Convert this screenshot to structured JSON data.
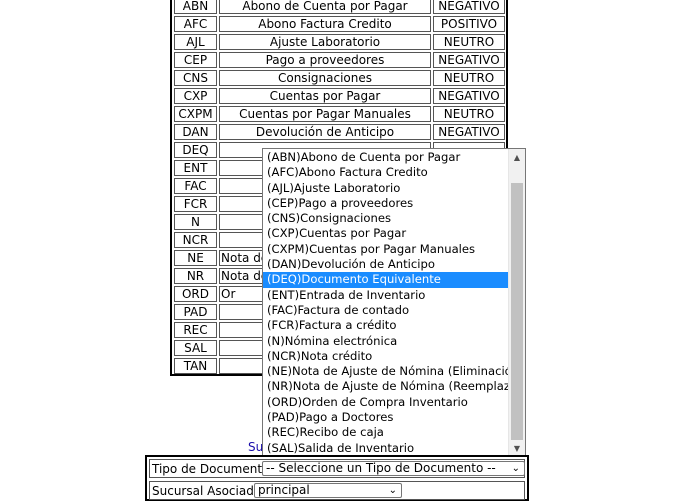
{
  "table": {
    "rows": [
      {
        "code": "ABN",
        "desc": "Abono de Cuenta por Pagar",
        "tipo": "NEGATIVO"
      },
      {
        "code": "AFC",
        "desc": "Abono Factura Credito",
        "tipo": "POSITIVO"
      },
      {
        "code": "AJL",
        "desc": "Ajuste Laboratorio",
        "tipo": "NEUTRO"
      },
      {
        "code": "CEP",
        "desc": "Pago a proveedores",
        "tipo": "NEGATIVO"
      },
      {
        "code": "CNS",
        "desc": "Consignaciones",
        "tipo": "NEUTRO"
      },
      {
        "code": "CXP",
        "desc": "Cuentas por Pagar",
        "tipo": "NEGATIVO"
      },
      {
        "code": "CXPM",
        "desc": "Cuentas por Pagar Manuales",
        "tipo": "NEUTRO"
      },
      {
        "code": "DAN",
        "desc": "Devolución de Anticipo",
        "tipo": "NEGATIVO"
      },
      {
        "code": "DEQ",
        "desc": "",
        "tipo": ""
      },
      {
        "code": "ENT",
        "desc": "",
        "tipo": ""
      },
      {
        "code": "FAC",
        "desc": "",
        "tipo": ""
      },
      {
        "code": "FCR",
        "desc": "",
        "tipo": ""
      },
      {
        "code": "N",
        "desc": "",
        "tipo": ""
      },
      {
        "code": "NCR",
        "desc": "",
        "tipo": ""
      },
      {
        "code": "NE",
        "desc": "Nota de",
        "tipo": ""
      },
      {
        "code": "NR",
        "desc": "Nota de",
        "tipo": ""
      },
      {
        "code": "ORD",
        "desc": "Or",
        "tipo": ""
      },
      {
        "code": "PAD",
        "desc": "",
        "tipo": ""
      },
      {
        "code": "REC",
        "desc": "",
        "tipo": ""
      },
      {
        "code": "SAL",
        "desc": "",
        "tipo": ""
      },
      {
        "code": "TAN",
        "desc": "",
        "tipo": ""
      }
    ]
  },
  "dropdown": {
    "selected_index": 8,
    "options": [
      "(ABN)Abono de Cuenta por Pagar",
      "(AFC)Abono Factura Credito",
      "(AJL)Ajuste Laboratorio",
      "(CEP)Pago a proveedores",
      "(CNS)Consignaciones",
      "(CXP)Cuentas por Pagar",
      "(CXPM)Cuentas por Pagar Manuales",
      "(DAN)Devolución de Anticipo",
      "(DEQ)Documento Equivalente",
      "(ENT)Entrada de Inventario",
      "(FAC)Factura de contado",
      "(FCR)Factura a crédito",
      "(N)Nómina electrónica",
      "(NCR)Nota crédito",
      "(NE)Nota de Ajuste de Nómina (Eliminación)",
      "(NR)Nota de Ajuste de Nómina (Reemplazo)",
      "(ORD)Orden de Compra Inventario",
      "(PAD)Pago a Doctores",
      "(REC)Recibo de caja",
      "(SAL)Salida de Inventario"
    ]
  },
  "link_partial": "Su",
  "form": {
    "tipo_label": "Tipo de Documento:",
    "tipo_value": "-- Seleccione un Tipo de Documento --",
    "sucursal_label": "Sucursal Asociado:",
    "sucursal_value": "principal"
  },
  "colors": {
    "selection": "#1a8cff",
    "link": "#1a0dab"
  },
  "icons": {
    "scroll_up": "triangle-up-icon",
    "scroll_down": "triangle-down-icon",
    "select": "chevron-down-icon"
  }
}
